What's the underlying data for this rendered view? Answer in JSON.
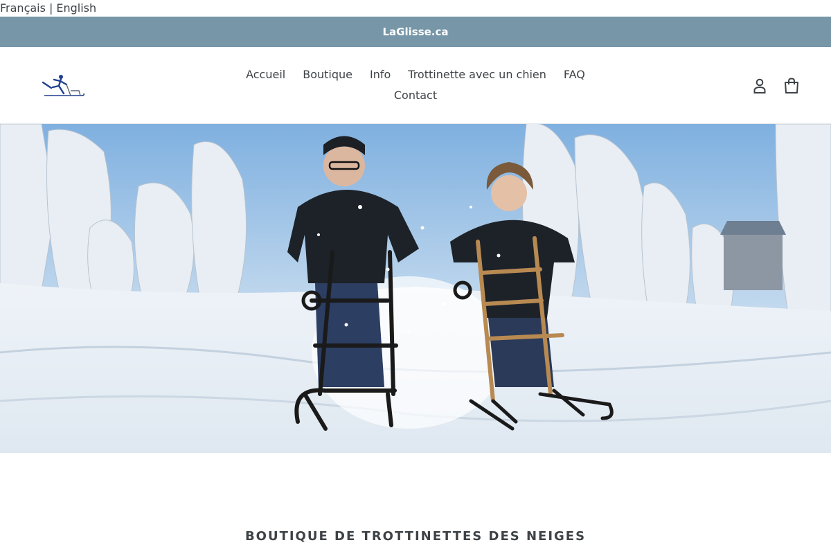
{
  "language": {
    "french": "Français",
    "separator": "|",
    "english": "English"
  },
  "announcement": {
    "text": "LaGlisse.ca"
  },
  "nav": {
    "row1": [
      "Accueil",
      "Boutique",
      "Info",
      "Trottinette avec un chien",
      "FAQ"
    ],
    "row2": [
      "Contact"
    ]
  },
  "header_icons": [
    "account-icon",
    "cart-icon"
  ],
  "colors": {
    "announcement_bg": "#7796a8",
    "text": "#3d4246",
    "logo_blue": "#1f3f8f"
  },
  "section": {
    "title": "BOUTIQUE DE TROTTINETTES DES NEIGES"
  }
}
